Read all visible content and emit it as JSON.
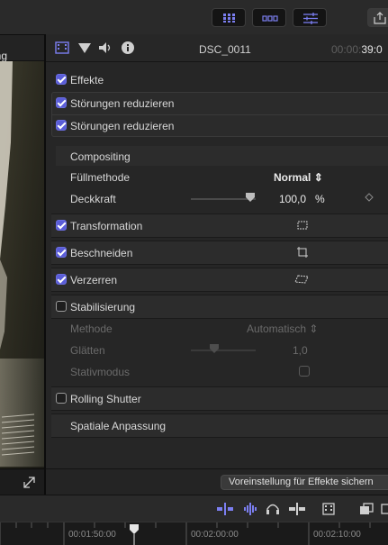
{
  "viewer": {
    "header_label": "ung"
  },
  "inspector": {
    "clip_title": "DSC_0011",
    "timecode_dim": "00:00:",
    "timecode_bright": "39:0",
    "effects_label": "Effekte",
    "effects_checked": true,
    "noise_rows": [
      {
        "label": "Störungen reduzieren",
        "checked": true
      },
      {
        "label": "Störungen reduzieren",
        "checked": true
      }
    ],
    "compositing": {
      "label": "Compositing",
      "blend_label": "Füllmethode",
      "blend_value": "Normal",
      "opacity_label": "Deckkraft",
      "opacity_value": "100,0",
      "opacity_unit": "%",
      "opacity_level": 1.0
    },
    "transform_label": "Transformation",
    "transform_checked": true,
    "crop_label": "Beschneiden",
    "crop_checked": true,
    "distort_label": "Verzerren",
    "distort_checked": true,
    "stabilization": {
      "label": "Stabilisierung",
      "checked": false,
      "method_label": "Methode",
      "method_value": "Automatisch",
      "smooth_label": "Glätten",
      "smooth_value": "1,0",
      "tripod_label": "Stativmodus"
    },
    "rolling_shutter_label": "Rolling Shutter",
    "rolling_shutter_checked": false,
    "spatial_label": "Spatiale Anpassung",
    "preset_button": "Voreinstellung für Effekte sichern"
  },
  "timeline": {
    "ticks": [
      "00:01:50:00",
      "00:02:00:00",
      "00:02:10:00"
    ],
    "tick_prefix": "|"
  },
  "colors": {
    "accent": "#5a5dd8",
    "background": "#262626"
  }
}
